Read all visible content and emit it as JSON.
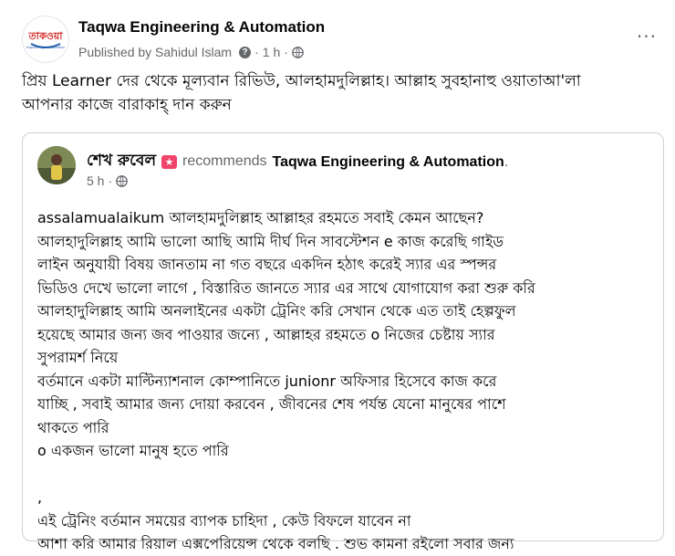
{
  "post": {
    "page_name": "Taqwa Engineering & Automation",
    "logo_text": "তাকওয়া",
    "logo_subtext": "Engineering & Automation",
    "published_by": "Published by Sahidul Islam",
    "time": "1 h",
    "separator": "·",
    "more_options": "···",
    "text_lines": [
      "প্রিয় Learner দের থেকে মূল্যবান রিভিউ, আলহামদুলিল্লাহ।  আল্লাহ সুবহানাহু ওয়াতাআ'লা",
      "আপনার কাজে বারাকাহ্ দান করুন"
    ]
  },
  "review": {
    "user_name": "শেখ রুবেল",
    "badge": "★",
    "verb": "recommends",
    "page_name": "Taqwa Engineering & Automation",
    "period": ".",
    "time": "5 h",
    "separator": "·",
    "lines": [
      "assalamualaikum আলহামদুলিল্লাহ আল্লাহর রহমতে সবাই কেমন আছেন?",
      "আলহাদুলিল্লাহ আমি ভালো আছি  আমি দীর্ঘ দিন সাবস্টেশন e কাজ করেছি গাইড",
      "লাইন অনুযায়ী বিষয় জানতাম না গত বছরে একদিন হঠাৎ করেই স্যার এর স্পন্সর",
      "ভিডিও দেখে ভালো লাগে , বিস্তারিত জানতে স্যার এর সাথে যোগাযোগ করা শুরু করি",
      "আলহাদুলিল্লাহ আমি অনলাইনের একটা ট্রেনিং করি  সেখান থেকে এত তাই হেল্পফুল",
      "হয়েছে আমার জন্য জব পাওয়ার জন্যে , আল্লাহর রহমতে o নিজের চেষ্টায় স্যার",
      "সুপরামর্শ নিয়ে",
      "বর্তমানে একটা মাল্টিন্যাশনাল কোম্পানিতে junionr অফিসার হিসেবে কাজ করে",
      "যাচ্ছি , সবাই আমার জন্য দোয়া করবেন , জীবনের শেষ পর্যন্ত যেনো মানুষের পাশে",
      "থাকতে পারি",
      "o একজন ভালো মানুষ হতে পারি",
      "",
      ",",
      "এই ট্রেনিং বর্তমান সময়ের ব্যাপক চাহিদা , কেউ বিফলে যাবেন না",
      "আশা করি আমার রিয়াল এক্সপেরিয়েন্স থেকে বলছি . শুভ কামনা রইলো সবার জন্য"
    ]
  },
  "colors": {
    "text_primary": "#050505",
    "text_secondary": "#65676b",
    "card_border": "#ced0d4",
    "badge": "#f0446a",
    "logo_red": "#d62828",
    "logo_blue": "#1e5aa8"
  },
  "icons": {
    "help": "question-circle-icon",
    "audience": "globe-icon",
    "badge": "recommend-badge-icon"
  }
}
